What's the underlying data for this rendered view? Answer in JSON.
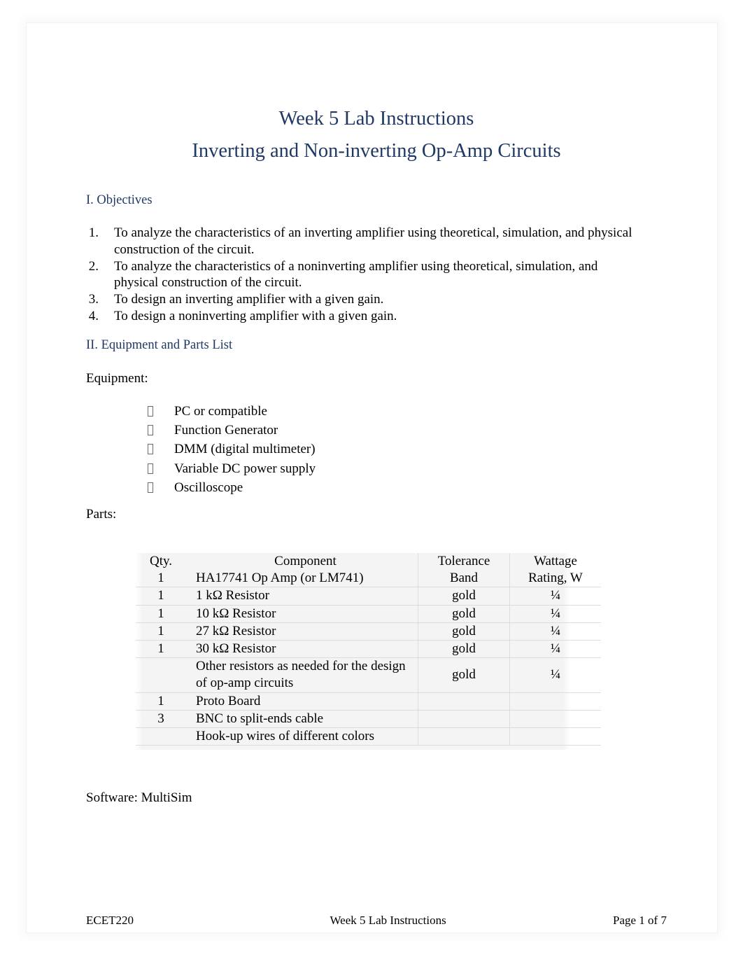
{
  "document": {
    "title_line_1": "Week 5 Lab Instructions",
    "title_line_2": "Inverting and Non-inverting Op-Amp Circuits",
    "heading_color": "#1F3864",
    "body_color": "#000000"
  },
  "sections": {
    "objectives": {
      "heading": "I. Objectives",
      "items": [
        "To analyze the characteristics of an inverting amplifier using theoretical, simulation, and physical construction of the circuit.",
        "To analyze the characteristics of a noninverting amplifier using theoretical, simulation, and physical construction of the circuit.",
        "To design an inverting amplifier with a given gain.",
        "To design a noninverting amplifier with a given gain."
      ],
      "numbers": [
        "1.",
        "2.",
        "3.",
        "4."
      ]
    },
    "equipment_parts": {
      "heading": "II. Equipment and Parts List",
      "equipment_label": "Equipment:",
      "equipment_bullet_glyph": "missing-glyph-box",
      "equipment_items": [
        "PC or compatible",
        "Function Generator",
        "DMM (digital multimeter)",
        "Variable DC power supply",
        "Oscilloscope"
      ],
      "parts_label": "Parts:",
      "software_line": "Software: MultiSim"
    }
  },
  "parts_table": {
    "headers": {
      "qty": "Qty.",
      "component": "Component",
      "tolerance_line_1": "Tolerance",
      "tolerance_line_2": "Band",
      "wattage_line_1": "Wattage",
      "wattage_line_2": "Rating, W"
    },
    "rows": [
      {
        "qty": "1",
        "component": "HA17741 Op Amp (or LM741)",
        "tolerance": "",
        "wattage": ""
      },
      {
        "qty": "1",
        "component": "1 kΩ Resistor",
        "tolerance": "gold",
        "wattage": "¼"
      },
      {
        "qty": "1",
        "component": "10 kΩ Resistor",
        "tolerance": "gold",
        "wattage": "¼"
      },
      {
        "qty": "1",
        "component": "27 kΩ Resistor",
        "tolerance": "gold",
        "wattage": "¼"
      },
      {
        "qty": "1",
        "component": "30 kΩ Resistor",
        "tolerance": "gold",
        "wattage": "¼"
      },
      {
        "qty": "",
        "component": "Other resistors as needed for the design of op-amp circuits",
        "tolerance": "gold",
        "wattage": "¼"
      },
      {
        "qty": "1",
        "component": "Proto Board",
        "tolerance": "",
        "wattage": ""
      },
      {
        "qty": "3",
        "component": "BNC to split-ends cable",
        "tolerance": "",
        "wattage": ""
      },
      {
        "qty": "",
        "component": "Hook-up wires of different colors",
        "tolerance": "",
        "wattage": ""
      }
    ]
  },
  "footer": {
    "left": "ECET220",
    "center": "Week 5 Lab Instructions",
    "right": "Page 1 of 7"
  }
}
